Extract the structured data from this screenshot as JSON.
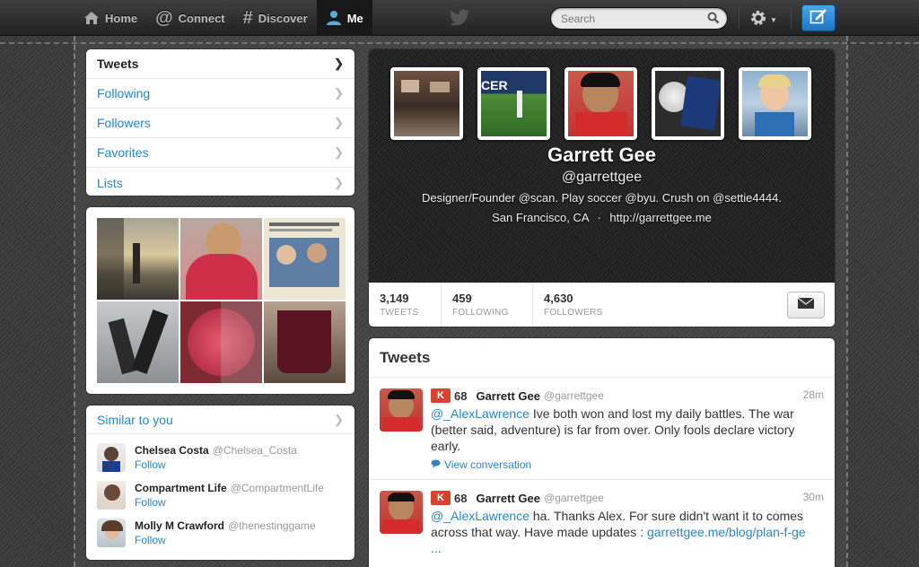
{
  "nav": {
    "items": [
      {
        "label": "Home",
        "icon": "home-icon"
      },
      {
        "label": "Connect",
        "icon": "at-icon"
      },
      {
        "label": "Discover",
        "icon": "hash-icon"
      },
      {
        "label": "Me",
        "icon": "person-icon"
      }
    ],
    "active": "Me"
  },
  "search": {
    "placeholder": "Search"
  },
  "colors": {
    "accent": "#2a85c4",
    "compose": "#1b76c4",
    "klout": "#d6432f"
  },
  "sidebar": {
    "menu": [
      {
        "label": "Tweets"
      },
      {
        "label": "Following"
      },
      {
        "label": "Followers"
      },
      {
        "label": "Favorites"
      },
      {
        "label": "Lists"
      }
    ]
  },
  "similar": {
    "title": "Similar to you",
    "users": [
      {
        "name": "Chelsea Costa",
        "handle": "@Chelsea_Costa",
        "follow": "Follow"
      },
      {
        "name": "Compartment Life",
        "handle": "@CompartmentLife",
        "follow": "Follow"
      },
      {
        "name": "Molly M Crawford",
        "handle": "@thenestinggame",
        "follow": "Follow"
      }
    ]
  },
  "profile": {
    "name": "Garrett Gee",
    "handle": "@garrettgee",
    "bio": "Designer/Founder @scan. Play soccer @byu. Crush on @settie4444.",
    "location": "San Francisco, CA",
    "separator": "·",
    "url": "http://garrettgee.me",
    "stats": [
      {
        "value": "3,149",
        "label": "TWEETS"
      },
      {
        "value": "459",
        "label": "FOLLOWING"
      },
      {
        "value": "4,630",
        "label": "FOLLOWERS"
      }
    ]
  },
  "tweets": {
    "title": "Tweets",
    "items": [
      {
        "klout": "68",
        "name": "Garrett Gee",
        "handle": "@garrettgee",
        "time": "28m",
        "mention": "@_AlexLawrence",
        "text": " Ive both won and lost my daily battles. The war (better said, adventure) is far from over. Only fools declare victory early.",
        "conversation": "View conversation"
      },
      {
        "klout": "68",
        "name": "Garrett Gee",
        "handle": "@garrettgee",
        "time": "30m",
        "mention": "@_AlexLawrence",
        "text": " ha. Thanks Alex. For sure didn't want it to comes across that way. Have made updates : ",
        "link": "garrettgee.me/blog/plan-f-ge",
        "ellipsis": "..."
      }
    ]
  }
}
